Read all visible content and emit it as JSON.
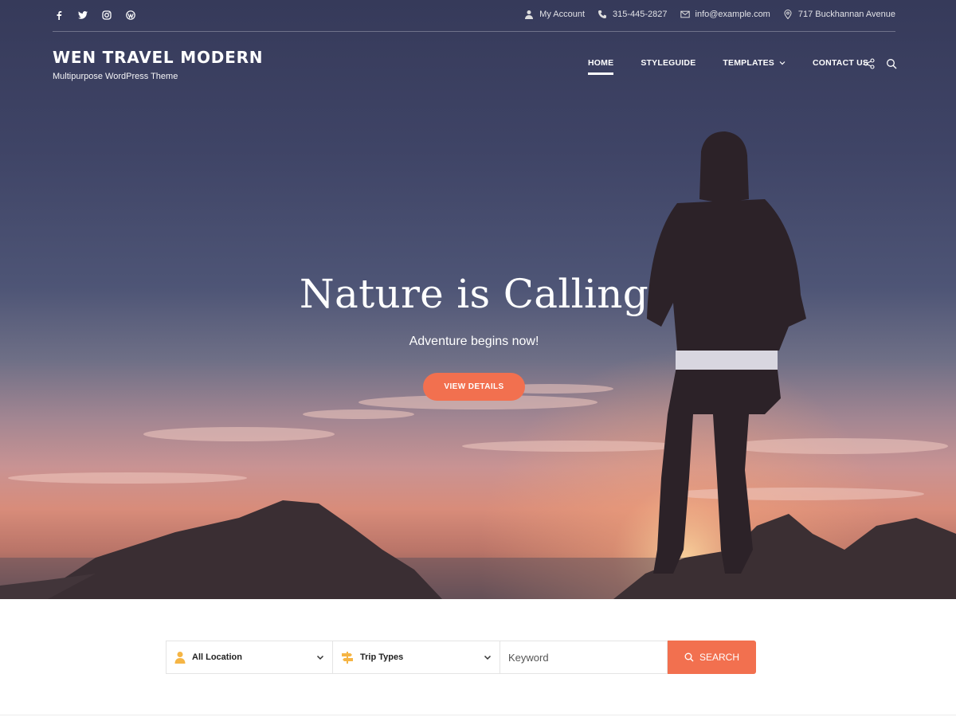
{
  "topbar": {
    "social": [
      "facebook-icon",
      "twitter-icon",
      "instagram-icon",
      "wordpress-icon"
    ],
    "account": "My Account",
    "phone": "315-445-2827",
    "email": "info@example.com",
    "address": "717 Buckhannan Avenue"
  },
  "brand": {
    "title": "WEN TRAVEL MODERN",
    "tagline": "Multipurpose WordPress Theme"
  },
  "nav": {
    "items": [
      {
        "label": "HOME",
        "active": true
      },
      {
        "label": "STYLEGUIDE"
      },
      {
        "label": "TEMPLATES",
        "has_dropdown": true
      },
      {
        "label": "CONTACT US"
      }
    ],
    "icons": [
      "share-icon",
      "search-icon"
    ]
  },
  "hero": {
    "title": "Nature is Calling",
    "subtitle": "Adventure begins now!",
    "button": "VIEW DETAILS"
  },
  "search": {
    "location": "All Location",
    "trip_types": "Trip Types",
    "keyword_placeholder": "Keyword",
    "button": "SEARCH"
  },
  "colors": {
    "accent": "#f2704f",
    "white": "#ffffff"
  }
}
